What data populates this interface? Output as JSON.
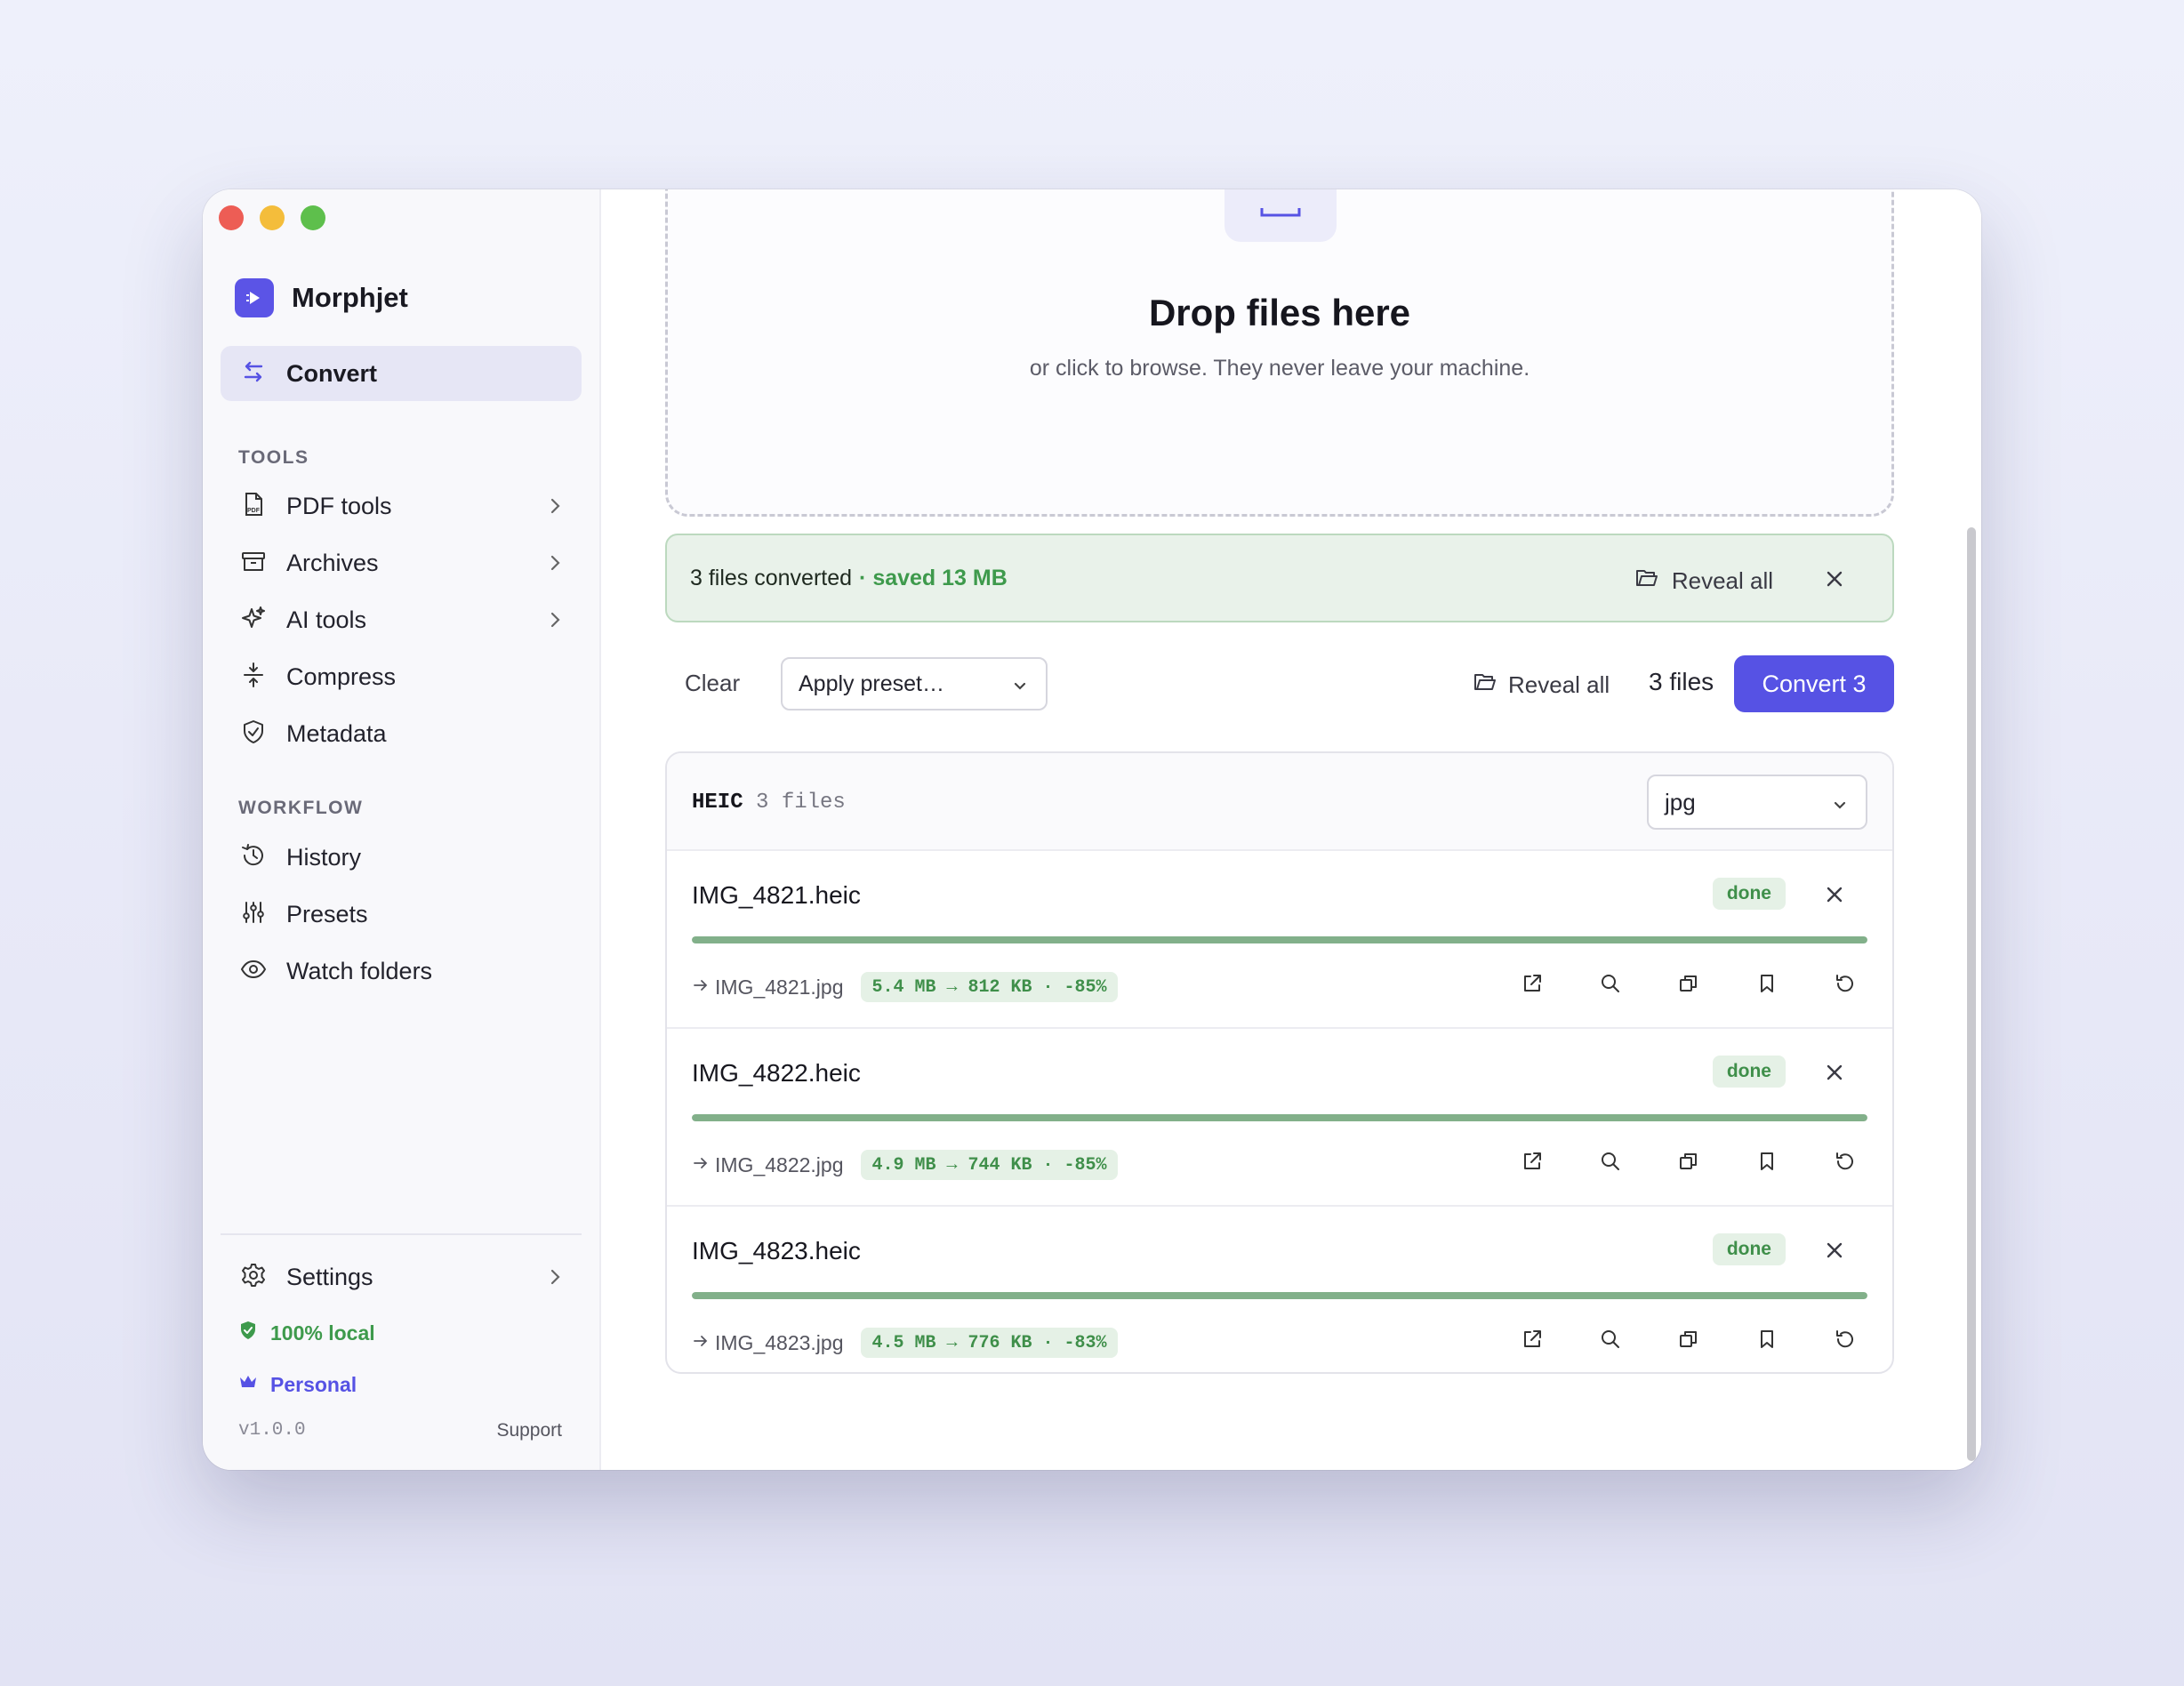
{
  "app": {
    "name": "Morphjet"
  },
  "sidebar": {
    "active": {
      "label": "Convert",
      "icon": "arrows-swap-icon"
    },
    "tools_heading": "TOOLS",
    "tools": [
      {
        "label": "PDF tools",
        "icon": "pdf-file-icon",
        "chevron": true
      },
      {
        "label": "Archives",
        "icon": "archive-box-icon",
        "chevron": true
      },
      {
        "label": "AI tools",
        "icon": "sparkles-icon",
        "chevron": true
      },
      {
        "label": "Compress",
        "icon": "compress-icon",
        "chevron": false
      },
      {
        "label": "Metadata",
        "icon": "shield-check-icon",
        "chevron": false
      }
    ],
    "workflow_heading": "WORKFLOW",
    "workflow": [
      {
        "label": "History",
        "icon": "history-icon"
      },
      {
        "label": "Presets",
        "icon": "sliders-icon"
      },
      {
        "label": "Watch folders",
        "icon": "eye-icon"
      }
    ],
    "settings_label": "Settings",
    "local_badge": "100% local",
    "plan_badge": "Personal",
    "version": "v1.0.0",
    "support": "Support"
  },
  "dropzone": {
    "title": "Drop files here",
    "subtitle": "or click to browse. They never leave your machine."
  },
  "banner": {
    "message": "3 files converted",
    "saved": "· saved 13 MB",
    "reveal_all": "Reveal all"
  },
  "toolbar": {
    "clear": "Clear",
    "preset_placeholder": "Apply preset…",
    "reveal_all": "Reveal all",
    "count": "3 files",
    "convert": "Convert 3"
  },
  "group": {
    "format": "HEIC",
    "count": "3 files",
    "target_format": "jpg"
  },
  "files": [
    {
      "name": "IMG_4821.heic",
      "status": "done",
      "progress": 1.0,
      "output": "IMG_4821.jpg",
      "delta": "5.4 MB → 812 KB · -85%"
    },
    {
      "name": "IMG_4822.heic",
      "status": "done",
      "progress": 1.0,
      "output": "IMG_4822.jpg",
      "delta": "4.9 MB → 744 KB · -85%"
    },
    {
      "name": "IMG_4823.heic",
      "status": "done",
      "progress": 1.0,
      "output": "IMG_4823.jpg",
      "delta": "4.5 MB → 776 KB · -83%"
    }
  ],
  "colors": {
    "accent": "#5652e4",
    "success": "#3e9a4c",
    "progress": "#82b08a"
  }
}
